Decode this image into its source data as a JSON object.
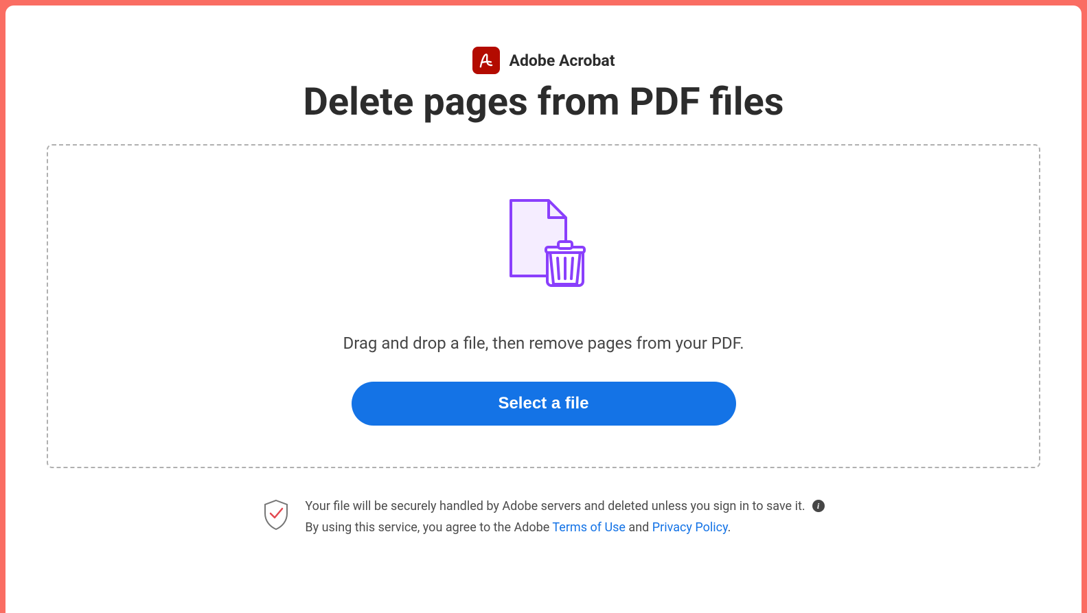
{
  "header": {
    "brand": "Adobe Acrobat",
    "title": "Delete pages from PDF files"
  },
  "dropzone": {
    "instruction": "Drag and drop a file, then remove pages from your PDF.",
    "button_label": "Select a file"
  },
  "footer": {
    "security_text": "Your file will be securely handled by Adobe servers and deleted unless you sign in to save it.",
    "agreement_prefix": "By using this service, you agree to the Adobe ",
    "terms_link": "Terms of Use",
    "agreement_and": " and ",
    "privacy_link": "Privacy Policy",
    "agreement_suffix": "."
  }
}
